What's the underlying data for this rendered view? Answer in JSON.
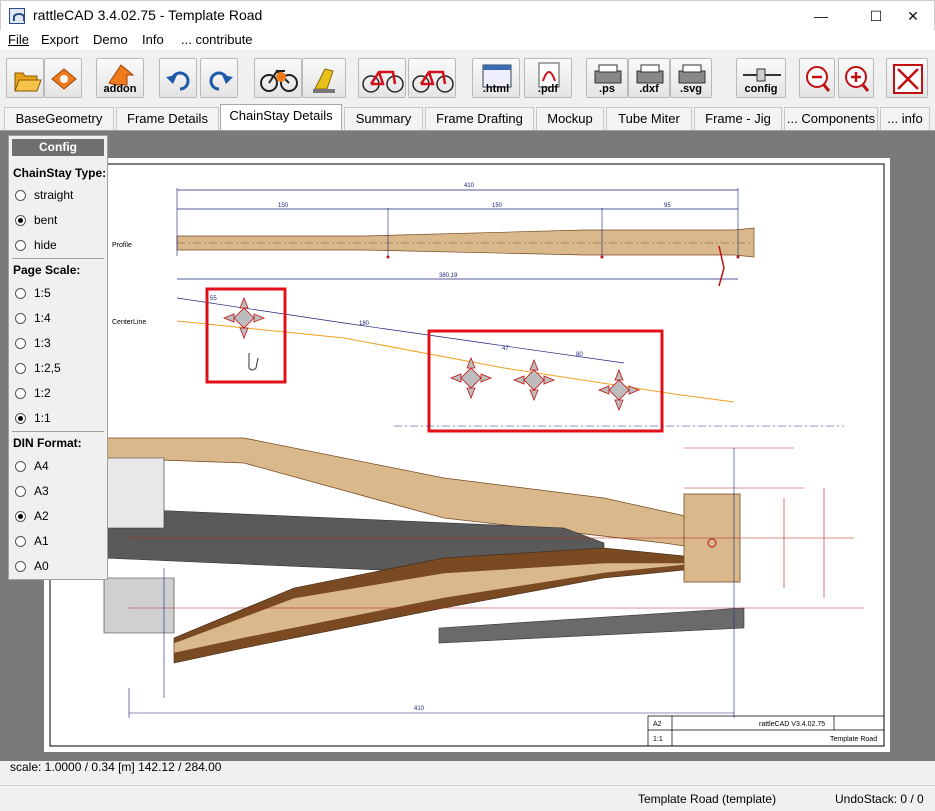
{
  "window": {
    "title": "rattleCAD  3.4.02.75 - Template Road",
    "minimize_glyph": "—",
    "maximize_glyph": "☐",
    "close_glyph": "✕"
  },
  "menu": [
    "File",
    "Export",
    "Demo",
    "Info",
    "... contribute"
  ],
  "toolbar": {
    "icons": [
      "open-folder-icon",
      "open-template-icon",
      "addon-icon",
      "undo-icon",
      "redo-icon",
      "bike-config-icon",
      "lamp-icon",
      "bike-red-icon",
      "bike-red-icon",
      "html-icon",
      "pdf-icon",
      "ps-icon",
      "dxf-icon",
      "svg-icon",
      "config-icon",
      "zoom-out-icon",
      "zoom-in-icon",
      "fit-window-icon"
    ],
    "labels": {
      "addon": "addon",
      "html": ".html",
      "pdf": ".pdf",
      "ps": ".ps",
      "dxf": ".dxf",
      "svg": ".svg",
      "config": "config"
    }
  },
  "tabs": [
    "BaseGeometry",
    "Frame Details",
    "ChainStay Details",
    "Summary",
    "Frame Drafting",
    "Mockup",
    "Tube Miter",
    "Frame - Jig",
    "... Components",
    "... info"
  ],
  "active_tab": "ChainStay Details",
  "config_panel": {
    "title": "Config",
    "chainstay_type": {
      "label": "ChainStay Type:",
      "options": [
        "straight",
        "bent",
        "hide"
      ],
      "selected": "bent"
    },
    "page_scale": {
      "label": "Page Scale:",
      "options": [
        "1:5",
        "1:4",
        "1:3",
        "1:2,5",
        "1:2",
        "1:1"
      ],
      "selected": "1:1"
    },
    "din_format": {
      "label": "DIN Format:",
      "options": [
        "A4",
        "A3",
        "A2",
        "A1",
        "A0"
      ],
      "selected": "A2"
    }
  },
  "drawing": {
    "profile_label": "Profile",
    "centerline_label": "CenterLine",
    "dims": {
      "total": "410",
      "d1": "150",
      "d2": "150",
      "d3": "95",
      "len": "380.19",
      "cl1": "55",
      "cl2": "180",
      "cl3": "47",
      "cl4": "80"
    },
    "title_block": {
      "format": "A2",
      "app": "rattleCAD   V3.4.02.75",
      "scale": "1:1",
      "project": "Template Road"
    }
  },
  "status": {
    "scale_line": "scale: 1.0000 / 0.34  [m]  142.12 / 284.00",
    "document": "Template Road (template)",
    "undo": "UndoStack:  0 / 0"
  },
  "colors": {
    "tube_fill": "#d9b88c",
    "tube_dark": "#7a4a22",
    "dim_blue": "#1a237e",
    "dim_red": "#b71c1c",
    "centerline": "#f0a020",
    "highlight": "#e0101a",
    "grey_part": "#5a5a5a"
  }
}
